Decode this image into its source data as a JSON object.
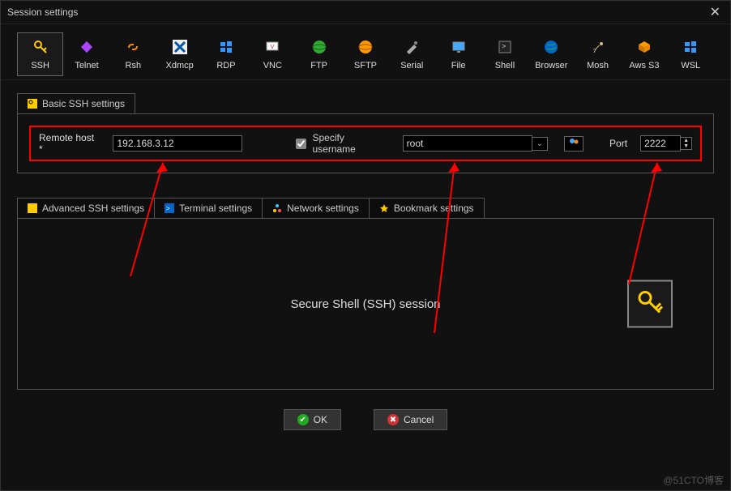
{
  "title": "Session settings",
  "tools": [
    {
      "label": "SSH"
    },
    {
      "label": "Telnet"
    },
    {
      "label": "Rsh"
    },
    {
      "label": "Xdmcp"
    },
    {
      "label": "RDP"
    },
    {
      "label": "VNC"
    },
    {
      "label": "FTP"
    },
    {
      "label": "SFTP"
    },
    {
      "label": "Serial"
    },
    {
      "label": "File"
    },
    {
      "label": "Shell"
    },
    {
      "label": "Browser"
    },
    {
      "label": "Mosh"
    },
    {
      "label": "Aws S3"
    },
    {
      "label": "WSL"
    }
  ],
  "basicTab": "Basic SSH settings",
  "form": {
    "hostLabel": "Remote host *",
    "host": "192.168.3.12",
    "specifyUser": "Specify username",
    "user": "root",
    "portLabel": "Port",
    "port": "2222"
  },
  "tabs": [
    "Advanced SSH settings",
    "Terminal settings",
    "Network settings",
    "Bookmark settings"
  ],
  "sessionLabel": "Secure Shell (SSH) session",
  "buttons": {
    "ok": "OK",
    "cancel": "Cancel"
  },
  "watermark": "@51CTO博客"
}
